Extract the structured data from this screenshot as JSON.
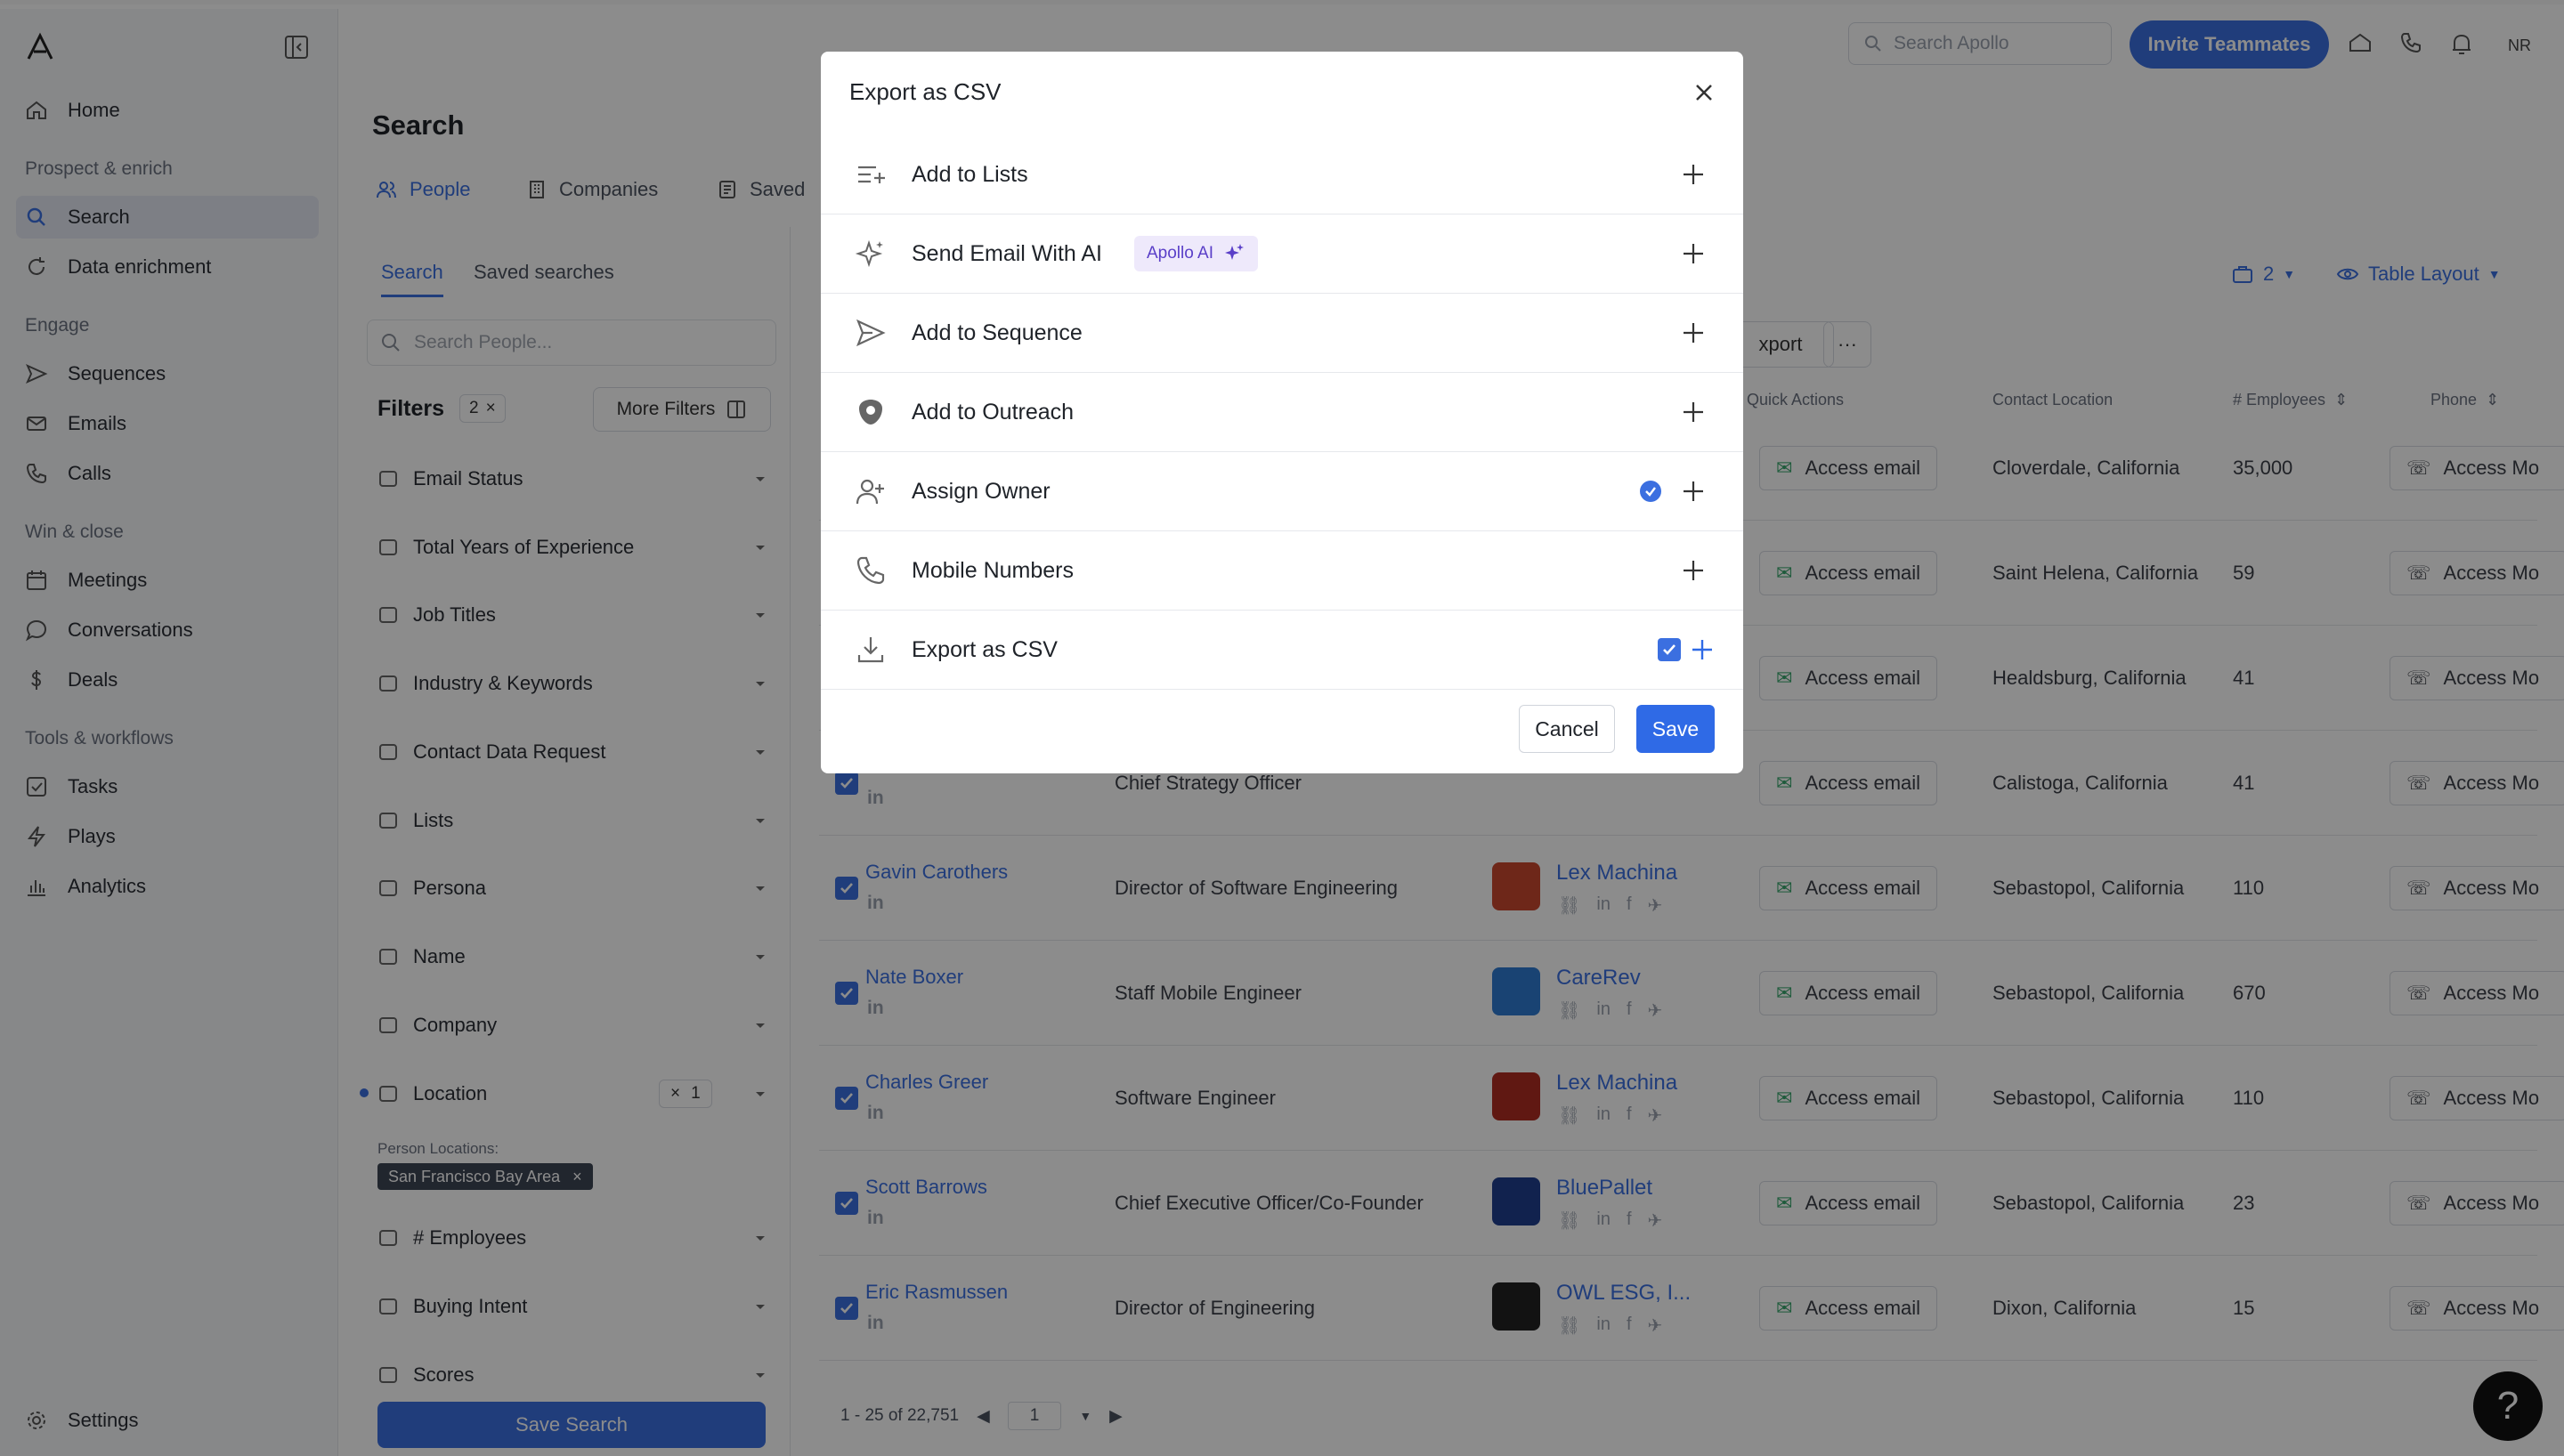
{
  "sidebar": {
    "items": {
      "home": "Home",
      "search": "Search",
      "data_enrichment": "Data enrichment",
      "sequences": "Sequences",
      "emails": "Emails",
      "calls": "Calls",
      "meetings": "Meetings",
      "conversations": "Conversations",
      "deals": "Deals",
      "tasks": "Tasks",
      "plays": "Plays",
      "analytics": "Analytics",
      "settings": "Settings"
    },
    "sections": {
      "prospect": "Prospect & enrich",
      "engage": "Engage",
      "win": "Win & close",
      "tools": "Tools & workflows"
    }
  },
  "header": {
    "search_placeholder": "Search Apollo",
    "invite_label": "Invite Teammates",
    "avatar_initials": "NR"
  },
  "page": {
    "title": "Search",
    "tabs": [
      "People",
      "Companies",
      "Saved"
    ],
    "subtabs": [
      "Search",
      "Saved searches"
    ],
    "people_search_placeholder": "Search People...",
    "filters_title": "Filters",
    "filters_count": "2",
    "more_filters": "More Filters",
    "filters": [
      "Email Status",
      "Total Years of Experience",
      "Job Titles",
      "Industry & Keywords",
      "Contact Data Request",
      "Lists",
      "Persona",
      "Name",
      "Company",
      "Location",
      "# Employees",
      "Buying Intent",
      "Scores"
    ],
    "location_count": "1",
    "location_label": "Person Locations:",
    "location_chip": "San Francisco Bay Area",
    "save_search": "Save Search"
  },
  "table": {
    "saved_count": "2",
    "layout_label": "Table Layout",
    "export_partial": "xport",
    "columns": {
      "quick_actions": "Quick Actions",
      "contact_location": "Contact Location",
      "employees": "# Employees",
      "phone": "Phone"
    },
    "access_email": "Access email",
    "access_mobile": "Access Mo",
    "rows": [
      {
        "name": "",
        "title": "",
        "company": "",
        "location": "Cloverdale, California",
        "employees": "35,000"
      },
      {
        "name": "",
        "title": "",
        "company": "",
        "location": "Saint Helena, California",
        "employees": "59"
      },
      {
        "name": "",
        "title": "",
        "company": "",
        "location": "Healdsburg, California",
        "employees": "41"
      },
      {
        "name": "",
        "title": "Chief Strategy Officer",
        "company": "",
        "location": "Calistoga, California",
        "employees": "41"
      },
      {
        "name": "Gavin Carothers",
        "title": "Director of Software Engineering",
        "company": "Lex Machina",
        "location": "Sebastopol, California",
        "employees": "110"
      },
      {
        "name": "Nate Boxer",
        "title": "Staff Mobile Engineer",
        "company": "CareRev",
        "location": "Sebastopol, California",
        "employees": "670"
      },
      {
        "name": "Charles Greer",
        "title": "Software Engineer",
        "company": "Lex Machina",
        "location": "Sebastopol, California",
        "employees": "110"
      },
      {
        "name": "Scott Barrows",
        "title": "Chief Executive Officer/Co-Founder",
        "company": "BluePallet",
        "location": "Sebastopol, California",
        "employees": "23"
      },
      {
        "name": "Eric Rasmussen",
        "title": "Director of Engineering",
        "company": "OWL ESG, I...",
        "location": "Dixon, California",
        "employees": "15"
      }
    ],
    "pager_range": "1 - 25 of 22,751",
    "pager_page": "1",
    "linkedin_glyph": "in"
  },
  "modal": {
    "title": "Export as CSV",
    "options": [
      "Add to Lists",
      "Send Email With AI",
      "Add to Sequence",
      "Add to Outreach",
      "Assign Owner",
      "Mobile Numbers",
      "Export as CSV"
    ],
    "ai_badge": "Apollo AI",
    "cancel": "Cancel",
    "save": "Save"
  },
  "help_label": "?",
  "colors": {
    "accent": "#3b6fe0",
    "save": "#2f6ae6",
    "ai_badge_bg": "#eee9fb"
  }
}
